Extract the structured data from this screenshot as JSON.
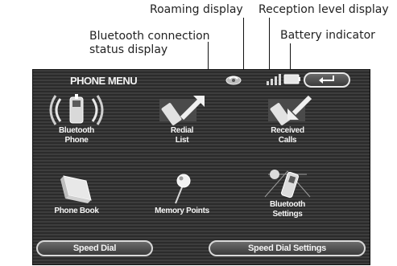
{
  "callouts": {
    "roaming": "Roaming display",
    "reception": "Reception level display",
    "bt_status_line1": "Bluetooth connection",
    "bt_status_line2": "status display",
    "battery": "Battery indicator"
  },
  "screen": {
    "title": "PHONE MENU",
    "tiles": [
      {
        "line1": "Bluetooth",
        "line2": "Phone"
      },
      {
        "line1": "Redial",
        "line2": "List"
      },
      {
        "line1": "Received",
        "line2": "Calls"
      },
      {
        "line1": "Phone Book",
        "line2": ""
      },
      {
        "line1": "Memory Points",
        "line2": ""
      },
      {
        "line1": "Bluetooth",
        "line2": "Settings"
      }
    ],
    "buttons": {
      "speed_dial": "Speed Dial",
      "speed_dial_settings": "Speed Dial Settings"
    }
  },
  "icons": {
    "back": "back-arrow-icon",
    "roaming": "roaming-icon",
    "reception": "signal-bars-icon",
    "battery": "battery-icon"
  }
}
